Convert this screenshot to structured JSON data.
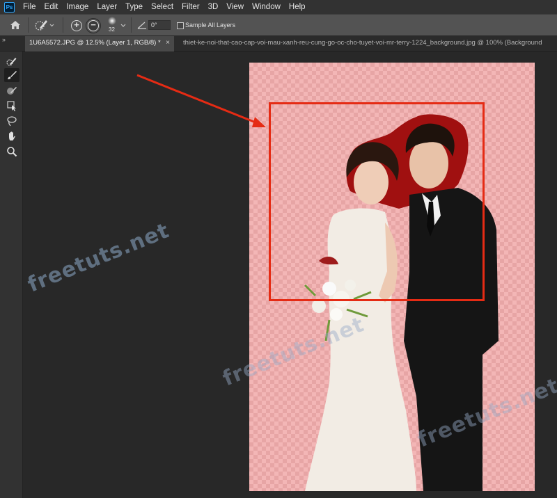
{
  "app": {
    "logo": "Ps"
  },
  "menu": [
    "File",
    "Edit",
    "Image",
    "Layer",
    "Type",
    "Select",
    "Filter",
    "3D",
    "View",
    "Window",
    "Help"
  ],
  "options": {
    "brush_size": "32",
    "angle_value": "0°",
    "sample_all_layers_label": "Sample All Layers",
    "sample_all_layers_checked": false,
    "icons": [
      "home-icon",
      "quick-selection-brush-icon",
      "add-to-selection-icon",
      "subtract-from-selection-icon",
      "brush-preset-icon",
      "angle-icon"
    ]
  },
  "tabs": [
    {
      "label": "1U6A5572.JPG @ 12.5% (Layer 1, RGB/8) *",
      "close": "×",
      "active": true
    },
    {
      "label": "thiet-ke-noi-that-cao-cap-voi-mau-xanh-reu-cung-go-oc-cho-tuyet-voi-mr-terry-1224_background.jpg @ 100% (Background",
      "active": false
    }
  ],
  "tabbar_expand": "»",
  "tools": [
    "quick-selection-tool",
    "brush-tool",
    "refine-edge-brush-tool",
    "object-selection-tool",
    "lasso-tool",
    "hand-tool",
    "zoom-tool"
  ],
  "watermarks": [
    "freetuts.net",
    "freetuts.net",
    "freetuts.net"
  ],
  "colors": {
    "accent_red": "#e52b14",
    "mask_overlay": "#f3b6b6",
    "subject_mask": "#a01010",
    "ps_blue": "#31a8ff"
  }
}
